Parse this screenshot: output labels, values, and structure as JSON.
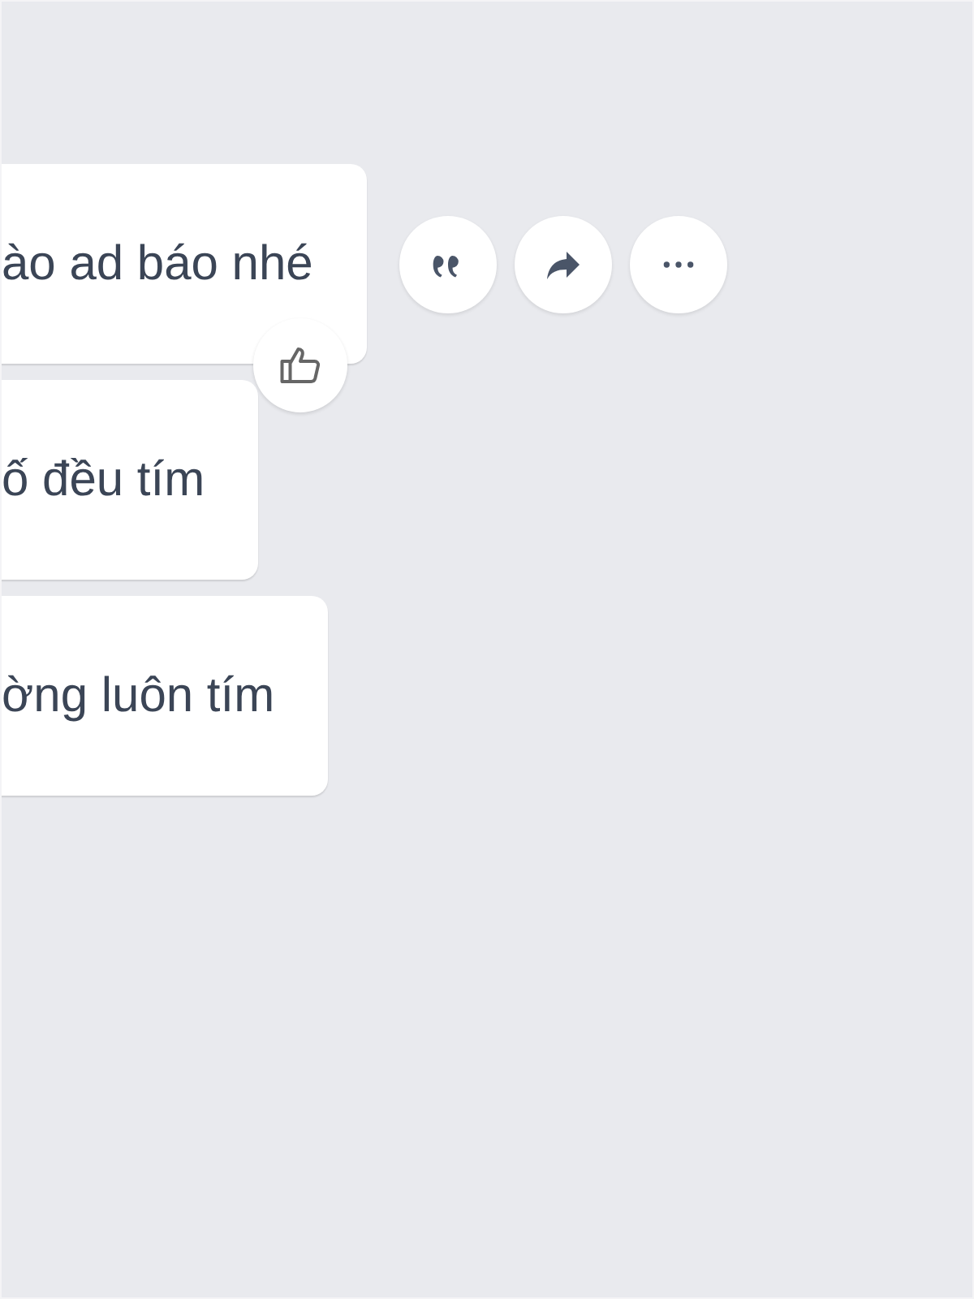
{
  "messages": [
    {
      "text": "ào ad báo nhé",
      "reaction": {
        "kind": "like"
      },
      "actions": [
        {
          "kind": "quote"
        },
        {
          "kind": "forward"
        },
        {
          "kind": "more"
        }
      ]
    },
    {
      "text": "ố đều tím"
    },
    {
      "text": "ờng luôn tím"
    }
  ]
}
